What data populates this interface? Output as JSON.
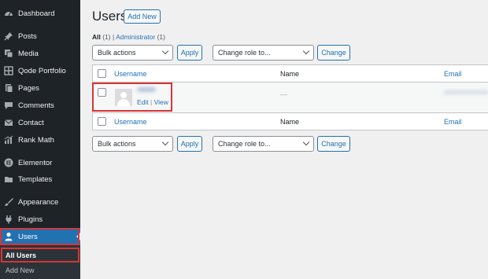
{
  "sidebar": {
    "items": [
      {
        "label": "Dashboard",
        "icon": "dashboard-icon"
      },
      {
        "label": "Posts",
        "icon": "pin-icon"
      },
      {
        "label": "Media",
        "icon": "media-icon"
      },
      {
        "label": "Qode Portfolio",
        "icon": "grid-icon"
      },
      {
        "label": "Pages",
        "icon": "page-icon"
      },
      {
        "label": "Comments",
        "icon": "comment-icon"
      },
      {
        "label": "Contact",
        "icon": "mail-icon"
      },
      {
        "label": "Rank Math",
        "icon": "chart-icon"
      },
      {
        "label": "Elementor",
        "icon": "elementor-icon"
      },
      {
        "label": "Templates",
        "icon": "folder-icon"
      },
      {
        "label": "Appearance",
        "icon": "brush-icon"
      },
      {
        "label": "Plugins",
        "icon": "plug-icon"
      },
      {
        "label": "Users",
        "icon": "user-icon"
      }
    ],
    "submenu": [
      "All Users",
      "Add New"
    ]
  },
  "header": {
    "title": "Users",
    "add_new": "Add New"
  },
  "filters": {
    "all_label": "All",
    "all_count": "(1)",
    "separator": "|",
    "admin_label": "Administrator",
    "admin_count": "(1)"
  },
  "bulk": {
    "select": "Bulk actions",
    "apply": "Apply",
    "role": "Change role to...",
    "change": "Change"
  },
  "table": {
    "col_username": "Username",
    "col_name": "Name",
    "col_email": "Email",
    "name_value": "—",
    "edit": "Edit",
    "pipe": "|",
    "view": "View"
  },
  "colors": {
    "accent": "#2271b1",
    "highlight": "#d63638",
    "sidebar": "#1d2327"
  }
}
